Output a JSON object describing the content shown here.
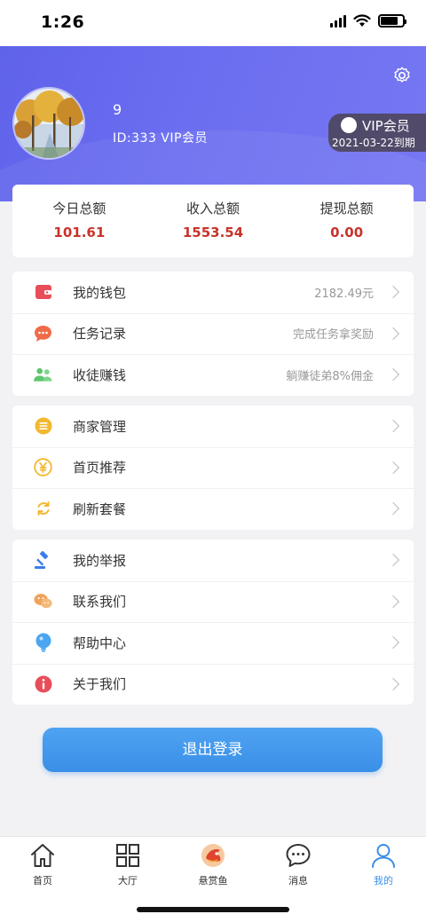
{
  "status_bar": {
    "time": "1:26"
  },
  "profile": {
    "name": "9",
    "id_line": "ID:333 VIP会员",
    "vip_label": "VIP会员",
    "vip_expiry": "2021-03-22到期"
  },
  "stats": [
    {
      "label": "今日总额",
      "value": "101.61"
    },
    {
      "label": "收入总额",
      "value": "1553.54"
    },
    {
      "label": "提现总额",
      "value": "0.00"
    }
  ],
  "group1": [
    {
      "label": "我的钱包",
      "value": "2182.49元",
      "icon": "wallet-icon",
      "color": "#e84e5a"
    },
    {
      "label": "任务记录",
      "value": "完成任务拿奖励",
      "icon": "chat-icon",
      "color": "#f06b48"
    },
    {
      "label": "收徒赚钱",
      "value": "躺赚徒弟8%佣金",
      "icon": "users-icon",
      "color": "#5cc66c"
    }
  ],
  "group2": [
    {
      "label": "商家管理",
      "icon": "menu-icon",
      "color": "#f2b830"
    },
    {
      "label": "首页推荐",
      "icon": "yen-icon",
      "color": "#f2b830"
    },
    {
      "label": "刷新套餐",
      "icon": "refresh-icon",
      "color": "#f2b830"
    }
  ],
  "group3": [
    {
      "label": "我的举报",
      "icon": "gavel-icon",
      "color": "#3a7ee8"
    },
    {
      "label": "联系我们",
      "icon": "wechat-icon",
      "color": "#f0a35a"
    },
    {
      "label": "帮助中心",
      "icon": "bulb-icon",
      "color": "#4aa6f0"
    },
    {
      "label": "关于我们",
      "icon": "info-icon",
      "color": "#e84e5a"
    }
  ],
  "logout_label": "退出登录",
  "tabs": [
    {
      "label": "首页",
      "icon": "home-icon"
    },
    {
      "label": "大厅",
      "icon": "grid-icon"
    },
    {
      "label": "悬赏鱼",
      "icon": "fish-logo-icon"
    },
    {
      "label": "消息",
      "icon": "message-icon"
    },
    {
      "label": "我的",
      "icon": "person-icon",
      "active": true
    }
  ],
  "colors": {
    "accent": "#3a8fe8",
    "header": "#6b6ef0",
    "amount": "#c8332b"
  }
}
